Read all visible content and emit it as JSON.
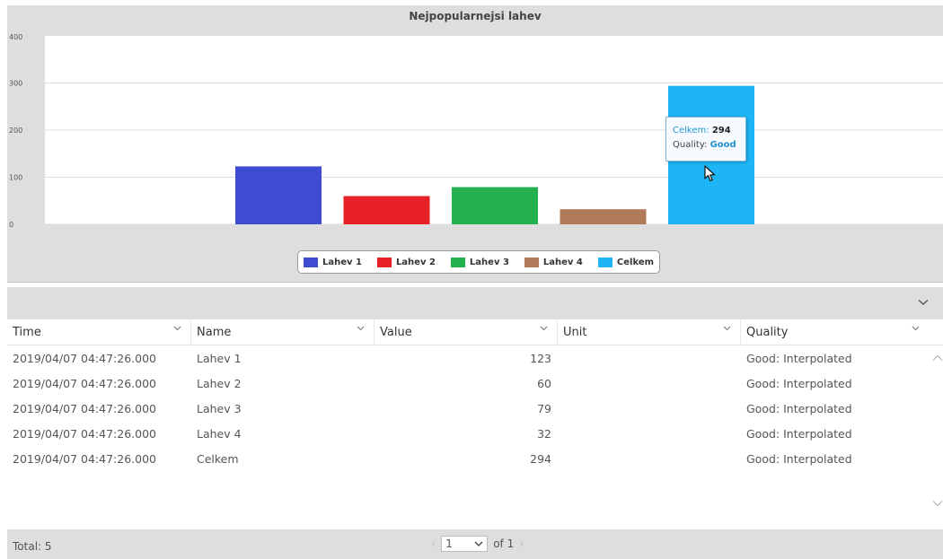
{
  "chart": {
    "title": "Nejpopularnejsi lahev",
    "tooltip": {
      "series_label": "Celkem:",
      "series_value": "294",
      "quality_label": "Quality:",
      "quality_value": "Good"
    }
  },
  "chart_data": {
    "type": "bar",
    "title": "Nejpopularnejsi lahev",
    "xlabel": "",
    "ylabel": "",
    "ylim": [
      0,
      400
    ],
    "yticks": [
      0,
      100,
      200,
      300,
      400
    ],
    "grid": true,
    "legend_position": "bottom",
    "series": [
      {
        "name": "Lahev 1",
        "value": 123,
        "color": "#3f4bd0"
      },
      {
        "name": "Lahev 2",
        "value": 60,
        "color": "#e82028"
      },
      {
        "name": "Lahev 3",
        "value": 79,
        "color": "#24b04f"
      },
      {
        "name": "Lahev 4",
        "value": 32,
        "color": "#b17a58"
      },
      {
        "name": "Celkem",
        "value": 294,
        "color": "#1db5f5"
      }
    ]
  },
  "table": {
    "columns": [
      "Time",
      "Name",
      "Value",
      "Unit",
      "Quality"
    ],
    "rows": [
      {
        "time": "2019/04/07 04:47:26.000",
        "name": "Lahev 1",
        "value": "123",
        "unit": "",
        "quality": "Good: Interpolated"
      },
      {
        "time": "2019/04/07 04:47:26.000",
        "name": "Lahev 2",
        "value": "60",
        "unit": "",
        "quality": "Good: Interpolated"
      },
      {
        "time": "2019/04/07 04:47:26.000",
        "name": "Lahev 3",
        "value": "79",
        "unit": "",
        "quality": "Good: Interpolated"
      },
      {
        "time": "2019/04/07 04:47:26.000",
        "name": "Lahev 4",
        "value": "32",
        "unit": "",
        "quality": "Good: Interpolated"
      },
      {
        "time": "2019/04/07 04:47:26.000",
        "name": "Celkem",
        "value": "294",
        "unit": "",
        "quality": "Good: Interpolated"
      }
    ],
    "footer": {
      "total": "Total: 5",
      "page": "1",
      "of_label": "of 1"
    }
  }
}
